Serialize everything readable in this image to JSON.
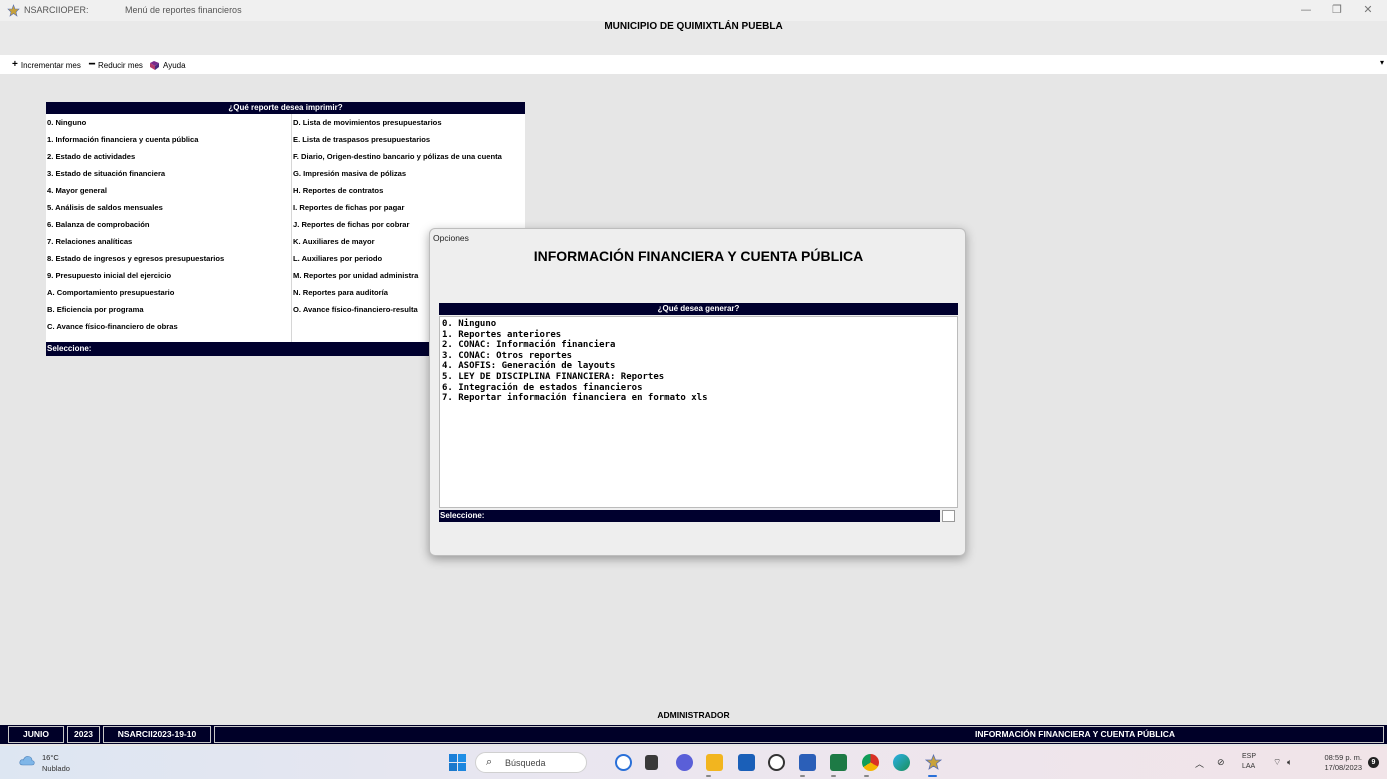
{
  "window": {
    "app_name": "NSARCIIOPER:",
    "title": "Menú de reportes financieros",
    "minimize_glyph": "—",
    "maximize_glyph": "❐",
    "close_glyph": "✕"
  },
  "header": {
    "municipality": "MUNICIPIO DE QUIMIXTLÁN PUEBLA"
  },
  "toolbar": {
    "increment_label": "Incrementar mes",
    "decrement_label": "Reducir mes",
    "help_label": "Ayuda",
    "overflow_glyph": "▾"
  },
  "report_menu": {
    "heading": "¿Qué reporte desea imprimir?",
    "left_options": [
      "0. Ninguno",
      "1. Información financiera y cuenta pública",
      "2. Estado de actividades",
      "3. Estado de situación financiera",
      "4. Mayor general",
      "5. Análisis de saldos mensuales",
      "6. Balanza de comprobación",
      "7. Relaciones analíticas",
      "8. Estado de ingresos y egresos presupuestarios",
      "9. Presupuesto inicial del ejercicio",
      "A. Comportamiento presupuestario",
      "B. Eficiencia por programa",
      "C. Avance físico-financiero de obras"
    ],
    "right_options": [
      "D. Lista de movimientos presupuestarios",
      "E. Lista de traspasos presupuestarios",
      "F. Diario, Origen-destino bancario y pólizas de una cuenta",
      "G. Impresión masiva de pólizas",
      "H. Reportes de contratos",
      "I. Reportes de fichas por pagar",
      "J. Reportes de fichas por cobrar",
      "K. Auxiliares de mayor",
      "L. Auxiliares por periodo",
      "M. Reportes por unidad administra",
      "N. Reportes para auditoría",
      "O. Avance físico-financiero-resulta"
    ],
    "select_label": "Seleccione:"
  },
  "dialog": {
    "window_title": "Opciones",
    "heading": "INFORMACIÓN FINANCIERA Y CUENTA PÚBLICA",
    "question": "¿Qué desea generar?",
    "options": [
      "0. Ninguno",
      "1. Reportes anteriores",
      "2. CONAC: Información financiera",
      "3. CONAC: Otros reportes",
      "4. ASOFIS: Generación de layouts",
      "5. LEY DE DISCIPLINA FINANCIERA: Reportes",
      "6. Integración de estados financieros",
      "7. Reportar información financiera en formato xls"
    ],
    "select_label": "Seleccione:"
  },
  "footer": {
    "user": "ADMINISTRADOR",
    "month": "JUNIO",
    "year": "2023",
    "database": "NSARCII2023-19-10",
    "current_module": "INFORMACIÓN FINANCIERA Y CUENTA PÚBLICA"
  },
  "taskbar": {
    "temperature": "16°C",
    "weather": "Nublado",
    "search_placeholder": "Búsqueda",
    "language": "ESP",
    "keyboard": "LAA",
    "time": "08:59 p. m.",
    "date": "17/08/2023",
    "notifications": "9"
  }
}
